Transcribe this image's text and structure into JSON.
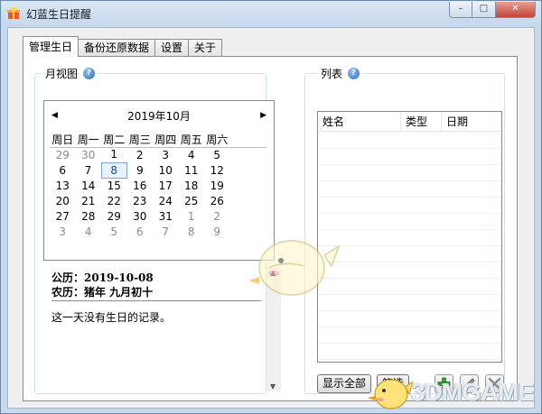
{
  "window": {
    "title": "幻蓝生日提醒"
  },
  "titlebar_buttons": {
    "minimize": "–",
    "maximize": "□",
    "close": "✕"
  },
  "tabs": [
    {
      "label": "管理生日",
      "active": true
    },
    {
      "label": "备份还原数据",
      "active": false
    },
    {
      "label": "设置",
      "active": false
    },
    {
      "label": "关于",
      "active": false
    }
  ],
  "left_panel": {
    "title": "月视图",
    "help_icon": "?",
    "calendar": {
      "month_label": "2019年10月",
      "prev": "◀",
      "next": "▶",
      "weekdays": [
        "周日",
        "周一",
        "周二",
        "周三",
        "周四",
        "周五",
        "周六"
      ],
      "weeks": [
        [
          {
            "d": "29",
            "other": true
          },
          {
            "d": "30",
            "other": true
          },
          {
            "d": "1"
          },
          {
            "d": "2"
          },
          {
            "d": "3"
          },
          {
            "d": "4"
          },
          {
            "d": "5"
          }
        ],
        [
          {
            "d": "6"
          },
          {
            "d": "7"
          },
          {
            "d": "8",
            "today": true
          },
          {
            "d": "9"
          },
          {
            "d": "10"
          },
          {
            "d": "11"
          },
          {
            "d": "12"
          }
        ],
        [
          {
            "d": "13"
          },
          {
            "d": "14"
          },
          {
            "d": "15"
          },
          {
            "d": "16"
          },
          {
            "d": "17"
          },
          {
            "d": "18"
          },
          {
            "d": "19"
          }
        ],
        [
          {
            "d": "20"
          },
          {
            "d": "21"
          },
          {
            "d": "22"
          },
          {
            "d": "23"
          },
          {
            "d": "24"
          },
          {
            "d": "25"
          },
          {
            "d": "26"
          }
        ],
        [
          {
            "d": "27"
          },
          {
            "d": "28"
          },
          {
            "d": "29"
          },
          {
            "d": "30"
          },
          {
            "d": "31"
          },
          {
            "d": "1",
            "other": true
          },
          {
            "d": "2",
            "other": true
          }
        ],
        [
          {
            "d": "3",
            "other": true
          },
          {
            "d": "4",
            "other": true
          },
          {
            "d": "5",
            "other": true
          },
          {
            "d": "6",
            "other": true
          },
          {
            "d": "7",
            "other": true
          },
          {
            "d": "8",
            "other": true
          },
          {
            "d": "9",
            "other": true
          }
        ]
      ]
    },
    "solar_line": "公历：2019-10-08",
    "lunar_line": "农历：猪年  九月初十",
    "no_record": "这一天没有生日的记录。",
    "scroll_up": "▲",
    "scroll_down": "▼"
  },
  "right_panel": {
    "title": "列表",
    "help_icon": "?",
    "columns": [
      "姓名",
      "类型",
      "日期"
    ],
    "buttons": {
      "show_all": "显示全部",
      "filter": "筛选"
    },
    "icons": [
      "add-icon",
      "edit-icon",
      "delete-icon"
    ]
  },
  "watermark": {
    "text": "3DMGAME"
  },
  "colors": {
    "accent": "#2e6fb8",
    "add_green": "#3aa23a",
    "close_red": "#c6433a"
  }
}
